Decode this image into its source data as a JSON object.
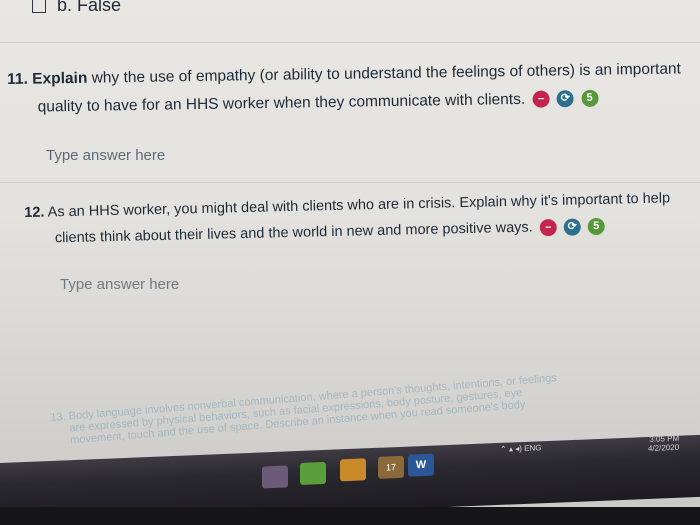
{
  "top_option": {
    "checkbox_icon": "checkbox-icon",
    "label": "b. False"
  },
  "q11": {
    "number": "11.",
    "bold_word": "Explain",
    "line1_rest": "why the use of empathy (or ability to understand the feelings of others) is an important",
    "line2": "quality to have for an HHS worker when they communicate with clients.",
    "badges": {
      "icon1": "minus-circle-icon",
      "icon2": "translate-icon",
      "count": "5"
    },
    "answer_placeholder": "Type answer here"
  },
  "q12": {
    "number": "12.",
    "line1": "As an HHS worker, you might deal with clients who are in crisis. Explain why it's important to help",
    "line2": "clients think about their lives and the world in new and more positive ways.",
    "badges": {
      "icon1": "minus-circle-icon",
      "icon2": "translate-icon",
      "count": "5"
    },
    "answer_placeholder": "Type answer here"
  },
  "q13": {
    "number": "13.",
    "line1": "Body language involves nonverbal communication, where a person's thoughts, intentions, or feelings",
    "line2": "are expressed by physical behaviors, such as facial expressions, body posture, gestures, eye",
    "line3": "movement, touch and the use of space. Describe an instance when you read someone's body"
  },
  "taskbar": {
    "word_label": "W",
    "tray_time": "3:05 PM",
    "tray_date": "4/2/2020",
    "tray_lang": "ENG",
    "badge_count": "17"
  },
  "colors": {
    "red": "#c2264f",
    "blue": "#2c6f8f",
    "green": "#58973a"
  }
}
